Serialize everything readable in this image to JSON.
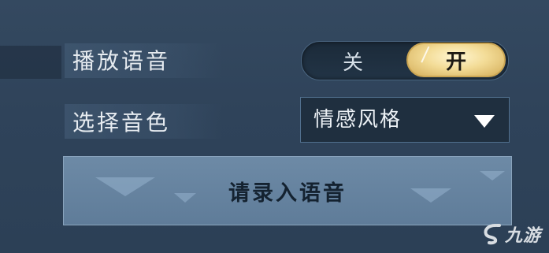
{
  "settings": {
    "voice_playback": {
      "label": "播放语音",
      "off_label": "关",
      "on_label": "开",
      "state": "on"
    },
    "voice_tone": {
      "label": "选择音色",
      "selected": "情感风格"
    },
    "record_button": {
      "label": "请录入语音"
    }
  },
  "watermark": {
    "text": "九游",
    "icon": "jiuyou-logo-icon"
  },
  "colors": {
    "background": "#2e4157",
    "toggle_on_gold": "#f3dc97",
    "dropdown_bg": "#1f2f3f",
    "record_button_bg": "#6d8aa6"
  }
}
